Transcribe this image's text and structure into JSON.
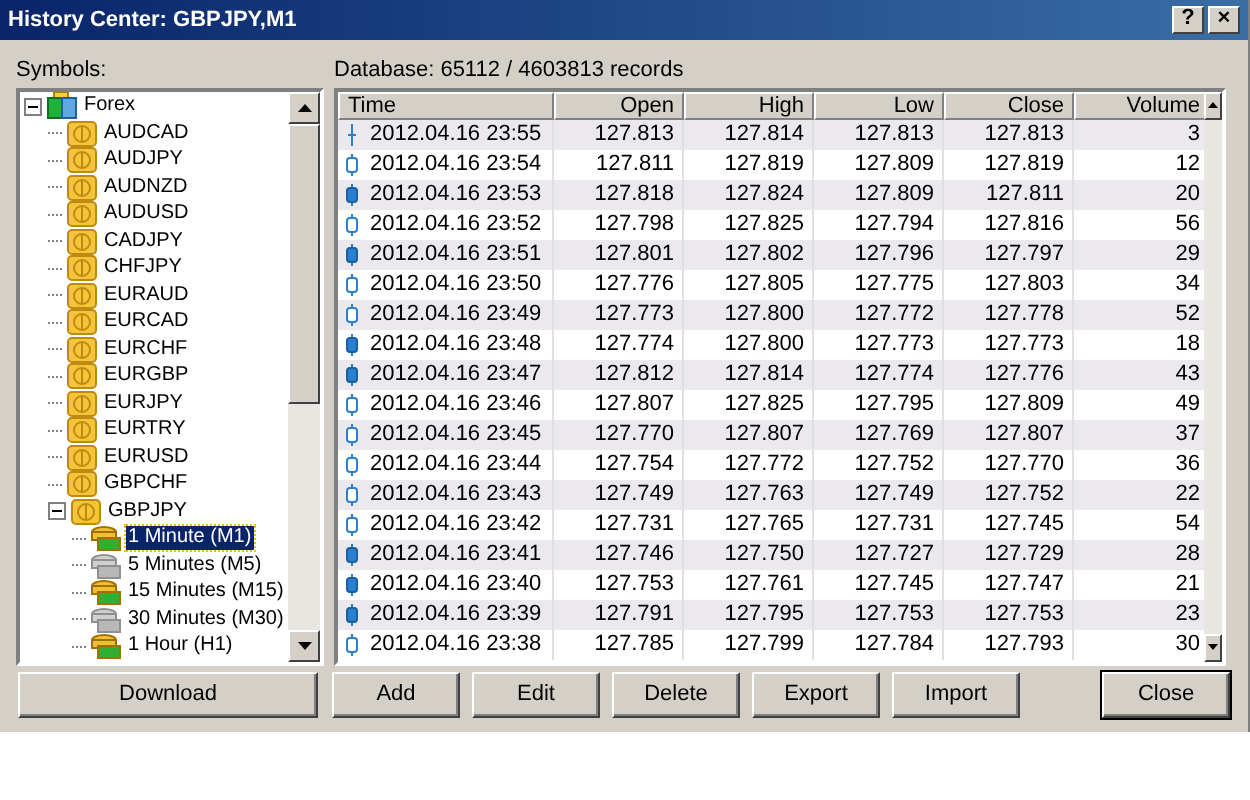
{
  "window": {
    "title": "History Center: GBPJPY,M1",
    "title_buttons": [
      "?",
      "×"
    ]
  },
  "symbols_label": "Symbols:",
  "tree": [
    {
      "label": "Forex",
      "kind": "folder",
      "expanded": true,
      "children": [
        {
          "label": "AUDCAD",
          "kind": "symbol"
        },
        {
          "label": "AUDJPY",
          "kind": "symbol"
        },
        {
          "label": "AUDNZD",
          "kind": "symbol"
        },
        {
          "label": "AUDUSD",
          "kind": "symbol"
        },
        {
          "label": "CADJPY",
          "kind": "symbol"
        },
        {
          "label": "CHFJPY",
          "kind": "symbol"
        },
        {
          "label": "EURAUD",
          "kind": "symbol"
        },
        {
          "label": "EURCAD",
          "kind": "symbol"
        },
        {
          "label": "EURCHF",
          "kind": "symbol"
        },
        {
          "label": "EURGBP",
          "kind": "symbol"
        },
        {
          "label": "EURJPY",
          "kind": "symbol"
        },
        {
          "label": "EURTRY",
          "kind": "symbol"
        },
        {
          "label": "EURUSD",
          "kind": "symbol"
        },
        {
          "label": "GBPCHF",
          "kind": "symbol"
        },
        {
          "label": "GBPJPY",
          "kind": "symbol",
          "expanded": true,
          "children": [
            {
              "label": "1 Minute (M1)",
              "kind": "timeframe",
              "available": true,
              "selected": true
            },
            {
              "label": "5 Minutes (M5)",
              "kind": "timeframe",
              "available": false,
              "selected": false
            },
            {
              "label": "15 Minutes (M15)",
              "kind": "timeframe",
              "available": true,
              "selected": false
            },
            {
              "label": "30 Minutes (M30)",
              "kind": "timeframe",
              "available": false,
              "selected": false
            },
            {
              "label": "1 Hour (H1)",
              "kind": "timeframe",
              "available": true,
              "selected": false
            }
          ]
        }
      ]
    }
  ],
  "database_info": "Database: 65112 / 4603813 records",
  "table": {
    "columns": [
      "Time",
      "Open",
      "High",
      "Low",
      "Close",
      "Volume"
    ],
    "rows": [
      {
        "kind": "doji",
        "cells": [
          "2012.04.16 23:55",
          "127.813",
          "127.814",
          "127.813",
          "127.813",
          "3"
        ]
      },
      {
        "kind": "bull",
        "cells": [
          "2012.04.16 23:54",
          "127.811",
          "127.819",
          "127.809",
          "127.819",
          "12"
        ]
      },
      {
        "kind": "bear",
        "cells": [
          "2012.04.16 23:53",
          "127.818",
          "127.824",
          "127.809",
          "127.811",
          "20"
        ]
      },
      {
        "kind": "bull",
        "cells": [
          "2012.04.16 23:52",
          "127.798",
          "127.825",
          "127.794",
          "127.816",
          "56"
        ]
      },
      {
        "kind": "bear",
        "cells": [
          "2012.04.16 23:51",
          "127.801",
          "127.802",
          "127.796",
          "127.797",
          "29"
        ]
      },
      {
        "kind": "bull",
        "cells": [
          "2012.04.16 23:50",
          "127.776",
          "127.805",
          "127.775",
          "127.803",
          "34"
        ]
      },
      {
        "kind": "bull",
        "cells": [
          "2012.04.16 23:49",
          "127.773",
          "127.800",
          "127.772",
          "127.778",
          "52"
        ]
      },
      {
        "kind": "bear",
        "cells": [
          "2012.04.16 23:48",
          "127.774",
          "127.800",
          "127.773",
          "127.773",
          "18"
        ]
      },
      {
        "kind": "bear",
        "cells": [
          "2012.04.16 23:47",
          "127.812",
          "127.814",
          "127.774",
          "127.776",
          "43"
        ]
      },
      {
        "kind": "bull",
        "cells": [
          "2012.04.16 23:46",
          "127.807",
          "127.825",
          "127.795",
          "127.809",
          "49"
        ]
      },
      {
        "kind": "bull",
        "cells": [
          "2012.04.16 23:45",
          "127.770",
          "127.807",
          "127.769",
          "127.807",
          "37"
        ]
      },
      {
        "kind": "bull",
        "cells": [
          "2012.04.16 23:44",
          "127.754",
          "127.772",
          "127.752",
          "127.770",
          "36"
        ]
      },
      {
        "kind": "bull",
        "cells": [
          "2012.04.16 23:43",
          "127.749",
          "127.763",
          "127.749",
          "127.752",
          "22"
        ]
      },
      {
        "kind": "bull",
        "cells": [
          "2012.04.16 23:42",
          "127.731",
          "127.765",
          "127.731",
          "127.745",
          "54"
        ]
      },
      {
        "kind": "bear",
        "cells": [
          "2012.04.16 23:41",
          "127.746",
          "127.750",
          "127.727",
          "127.729",
          "28"
        ]
      },
      {
        "kind": "bear",
        "cells": [
          "2012.04.16 23:40",
          "127.753",
          "127.761",
          "127.745",
          "127.747",
          "21"
        ]
      },
      {
        "kind": "bear",
        "cells": [
          "2012.04.16 23:39",
          "127.791",
          "127.795",
          "127.753",
          "127.753",
          "23"
        ]
      },
      {
        "kind": "bull",
        "cells": [
          "2012.04.16 23:38",
          "127.785",
          "127.799",
          "127.784",
          "127.793",
          "30"
        ]
      }
    ]
  },
  "buttons": {
    "left": [
      "Download"
    ],
    "right": [
      "Add",
      "Edit",
      "Delete",
      "Export",
      "Import"
    ],
    "close": "Close"
  }
}
